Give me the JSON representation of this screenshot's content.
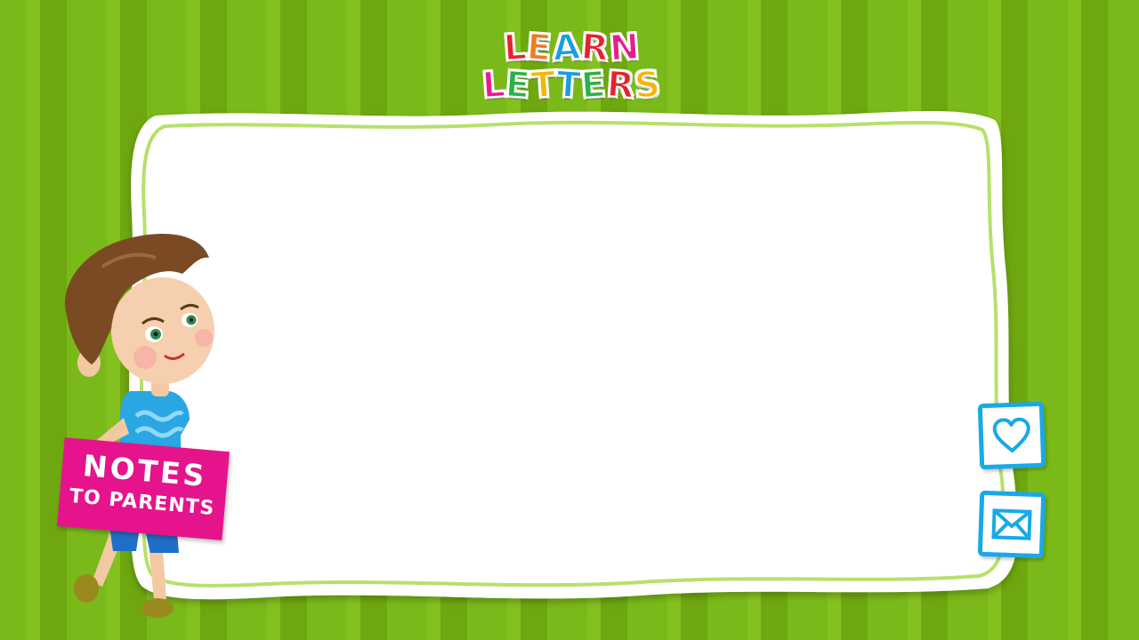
{
  "logo": {
    "line1": [
      "L",
      "E",
      "A",
      "R",
      "N"
    ],
    "line2": [
      "L",
      "E",
      "T",
      "T",
      "E",
      "R",
      "S"
    ],
    "line1_colors": [
      "#e8202c",
      "#f47920",
      "#1a9ce0",
      "#e8202c",
      "#e61e8c"
    ],
    "line2_colors": [
      "#e61e8c",
      "#2ab24a",
      "#f7b500",
      "#1a9ce0",
      "#2ab24a",
      "#e8202c",
      "#f7b500"
    ]
  },
  "sign": {
    "line1": "NOTES",
    "line2": "TO PARENTS"
  },
  "buttons": {
    "like_icon": "heart-icon",
    "mail_icon": "envelope-icon"
  },
  "colors": {
    "stripe_light": "#84c11f",
    "stripe_dark": "#6ea70f",
    "board_border": "#b6e06c",
    "sign_bg": "#e5148c",
    "button_border": "#18a9e6"
  }
}
